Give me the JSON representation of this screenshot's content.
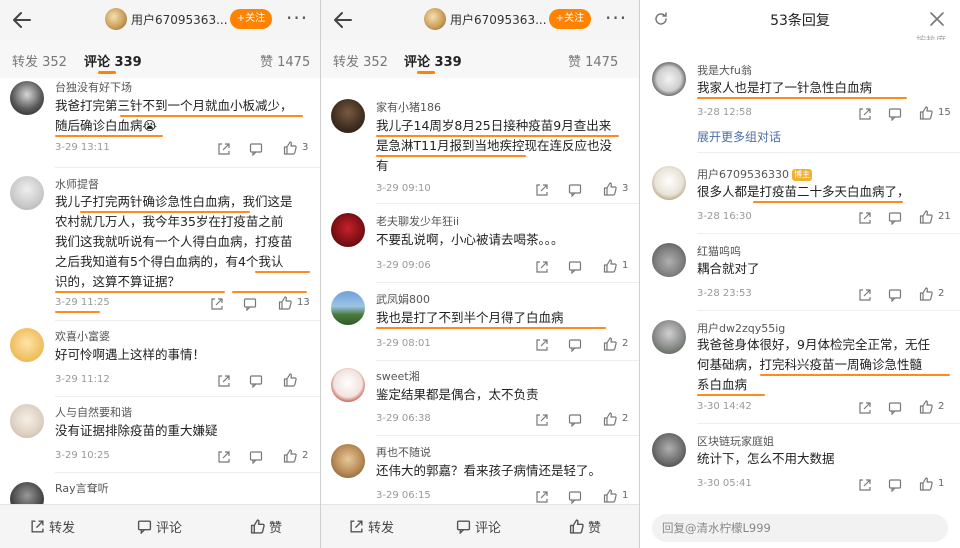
{
  "header": {
    "username": "用户67095363...",
    "follow_label": "+关注",
    "more": "···"
  },
  "tabs": {
    "repost": "转发 352",
    "comment": "评论 339",
    "like": "赞 1475"
  },
  "bottom": {
    "repost": "转发",
    "comment": "评论",
    "like": "赞"
  },
  "panel1": {
    "comments": [
      {
        "name": "台独没有好下场",
        "lines": [
          "我爸打完第三针不到一个月就血小板减少，",
          "随后确诊白血病😭"
        ],
        "time": "3-29 13:11",
        "likes": "3"
      },
      {
        "name": "水师提督",
        "lines": [
          "我儿子打完两针确诊急性白血病，我们这是",
          "农村就几万人，我今年35岁在打疫苗之前",
          "我们这我就听说有一个人得白血病，打疫苗",
          "之后我知道有5个得白血病的，有4个我认",
          "识的，这算不算证据？"
        ],
        "time": "3-29 11:25",
        "likes": "13"
      },
      {
        "name": "欢喜小富婆",
        "lines": [
          "好可怜啊遇上这样的事情！"
        ],
        "time": "3-29 11:12",
        "likes": ""
      },
      {
        "name": "人与自然要和谐",
        "lines": [
          "没有证据排除疫苗的重大嫌疑"
        ],
        "time": "3-29 10:25",
        "likes": "2"
      },
      {
        "name": "Ray言耷听",
        "lines": [],
        "time": "",
        "likes": ""
      }
    ]
  },
  "panel2": {
    "comments": [
      {
        "name": "家有小猪186",
        "lines": [
          "我儿子14周岁8月25日接种疫苗9月查出来",
          "是急淋T11月报到当地疾控现在连反应也没",
          "有"
        ],
        "time": "3-29 09:10",
        "likes": "3"
      },
      {
        "name": "老夫聊发少年狂ii",
        "lines": [
          "不要乱说啊，小心被请去喝茶。。。"
        ],
        "time": "3-29 09:06",
        "likes": "1"
      },
      {
        "name": "武凤娟800",
        "lines": [
          "我也是打了不到半个月得了白血病"
        ],
        "time": "3-29 08:01",
        "likes": "2"
      },
      {
        "name": "sweet湘",
        "lines": [
          "鉴定结果都是偶合，太不负责"
        ],
        "time": "3-29 06:38",
        "likes": "2"
      },
      {
        "name": "再也不随说",
        "lines": [
          "还伟大的郭嘉？看来孩子病情还是轻了。"
        ],
        "time": "3-29 06:15",
        "likes": "1"
      }
    ]
  },
  "panel3": {
    "title": "53条回复",
    "ghost": "按热度",
    "expand": "展开更多组对话",
    "reply_placeholder": "回复@清水柠檬L999",
    "badge": "博主",
    "comments": [
      {
        "name": "我是大fu翁",
        "lines": [
          "我家人也是打了一针急性白血病"
        ],
        "time": "3-28 12:58",
        "likes": "15"
      },
      {
        "name": "用户6709536330",
        "lines": [
          "很多人都是打疫苗二十多天白血病了，"
        ],
        "time": "3-28 16:30",
        "likes": "21"
      },
      {
        "name": "红猫呜呜",
        "lines": [
          "耦合就对了"
        ],
        "time": "3-28 23:53",
        "likes": "2"
      },
      {
        "name": "用户dw2zqy55ig",
        "lines": [
          "我爸爸身体很好，9月体检完全正常，无任",
          "何基础病，打完科兴疫苗一周确诊急性髓",
          "系白血病"
        ],
        "time": "3-30 14:42",
        "likes": "2"
      },
      {
        "name": "区块链玩家庭姐",
        "lines": [
          "统计下，怎么不用大数据"
        ],
        "time": "3-30 05:41",
        "likes": "1"
      }
    ]
  }
}
